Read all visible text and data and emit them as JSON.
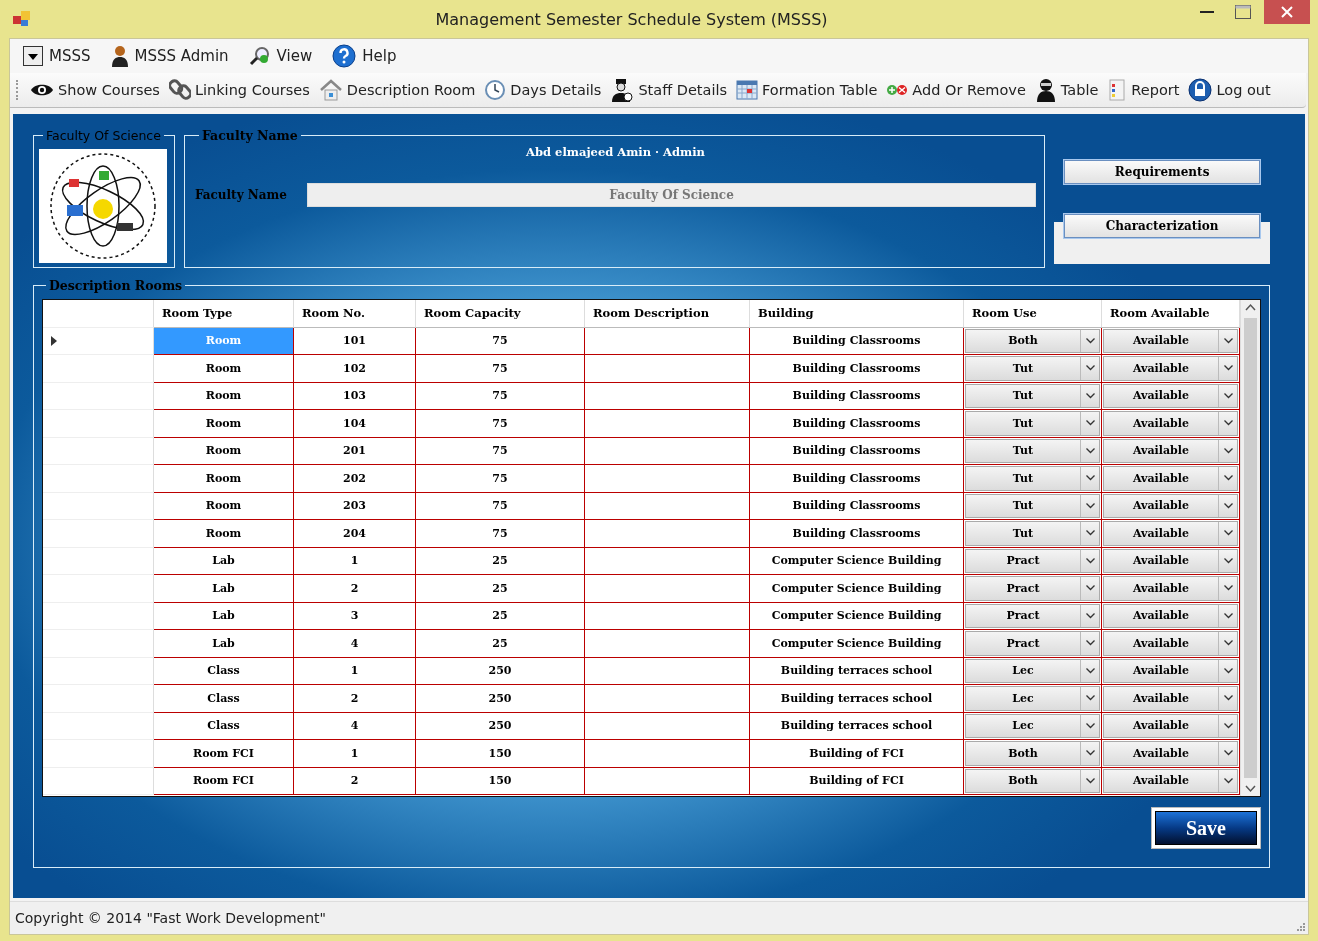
{
  "window": {
    "title": "Management Semester Schedule System (MSSS)"
  },
  "menu": [
    "MSSS",
    "MSSS Admin",
    "View",
    "Help"
  ],
  "toolbar": [
    "Show Courses",
    "Linking Courses",
    "Description Room",
    "Days Details",
    "Staff Details",
    "Formation Table",
    "Add Or Remove",
    "Table",
    "Report",
    "Log out"
  ],
  "faculty_group": {
    "title": "Faculty Of Science"
  },
  "faculty_name_group": {
    "title": "Faculty Name",
    "user": "Abd elmajeed Amin · Admin",
    "field_label": "Faculty Name",
    "field_value": "Faculty Of Science"
  },
  "side_buttons": [
    "Requirements",
    "Characterization"
  ],
  "rooms_group": {
    "title": "Description Rooms"
  },
  "table": {
    "columns": [
      "Room Type",
      "Room No.",
      "Room Capacity",
      "Room Description",
      "Building",
      "Room Use",
      "Room Available"
    ],
    "rows": [
      {
        "selected": true,
        "cells": [
          "Room",
          "101",
          "75",
          "",
          "Building Classrooms",
          "Both",
          "Available"
        ]
      },
      {
        "selected": false,
        "cells": [
          "Room",
          "102",
          "75",
          "",
          "Building Classrooms",
          "Tut",
          "Available"
        ]
      },
      {
        "selected": false,
        "cells": [
          "Room",
          "103",
          "75",
          "",
          "Building Classrooms",
          "Tut",
          "Available"
        ]
      },
      {
        "selected": false,
        "cells": [
          "Room",
          "104",
          "75",
          "",
          "Building Classrooms",
          "Tut",
          "Available"
        ]
      },
      {
        "selected": false,
        "cells": [
          "Room",
          "201",
          "75",
          "",
          "Building Classrooms",
          "Tut",
          "Available"
        ]
      },
      {
        "selected": false,
        "cells": [
          "Room",
          "202",
          "75",
          "",
          "Building Classrooms",
          "Tut",
          "Available"
        ]
      },
      {
        "selected": false,
        "cells": [
          "Room",
          "203",
          "75",
          "",
          "Building Classrooms",
          "Tut",
          "Available"
        ]
      },
      {
        "selected": false,
        "cells": [
          "Room",
          "204",
          "75",
          "",
          "Building Classrooms",
          "Tut",
          "Available"
        ]
      },
      {
        "selected": false,
        "cells": [
          "Lab",
          "1",
          "25",
          "",
          "Computer Science Building",
          "Pract",
          "Available"
        ]
      },
      {
        "selected": false,
        "cells": [
          "Lab",
          "2",
          "25",
          "",
          "Computer Science Building",
          "Pract",
          "Available"
        ]
      },
      {
        "selected": false,
        "cells": [
          "Lab",
          "3",
          "25",
          "",
          "Computer Science Building",
          "Pract",
          "Available"
        ]
      },
      {
        "selected": false,
        "cells": [
          "Lab",
          "4",
          "25",
          "",
          "Computer Science Building",
          "Pract",
          "Available"
        ]
      },
      {
        "selected": false,
        "cells": [
          "Class",
          "1",
          "250",
          "",
          "Building terraces school",
          "Lec",
          "Available"
        ]
      },
      {
        "selected": false,
        "cells": [
          "Class",
          "2",
          "250",
          "",
          "Building terraces school",
          "Lec",
          "Available"
        ]
      },
      {
        "selected": false,
        "cells": [
          "Class",
          "4",
          "250",
          "",
          "Building terraces school",
          "Lec",
          "Available"
        ]
      },
      {
        "selected": false,
        "cells": [
          "Room FCI",
          "1",
          "150",
          "",
          "Building of FCI",
          "Both",
          "Available"
        ]
      },
      {
        "selected": false,
        "cells": [
          "Room FCI",
          "2",
          "150",
          "",
          "Building of FCI",
          "Both",
          "Available"
        ]
      }
    ]
  },
  "save_button": "Save",
  "status_bar": "Copyright © 2014 \"Fast Work Development\""
}
